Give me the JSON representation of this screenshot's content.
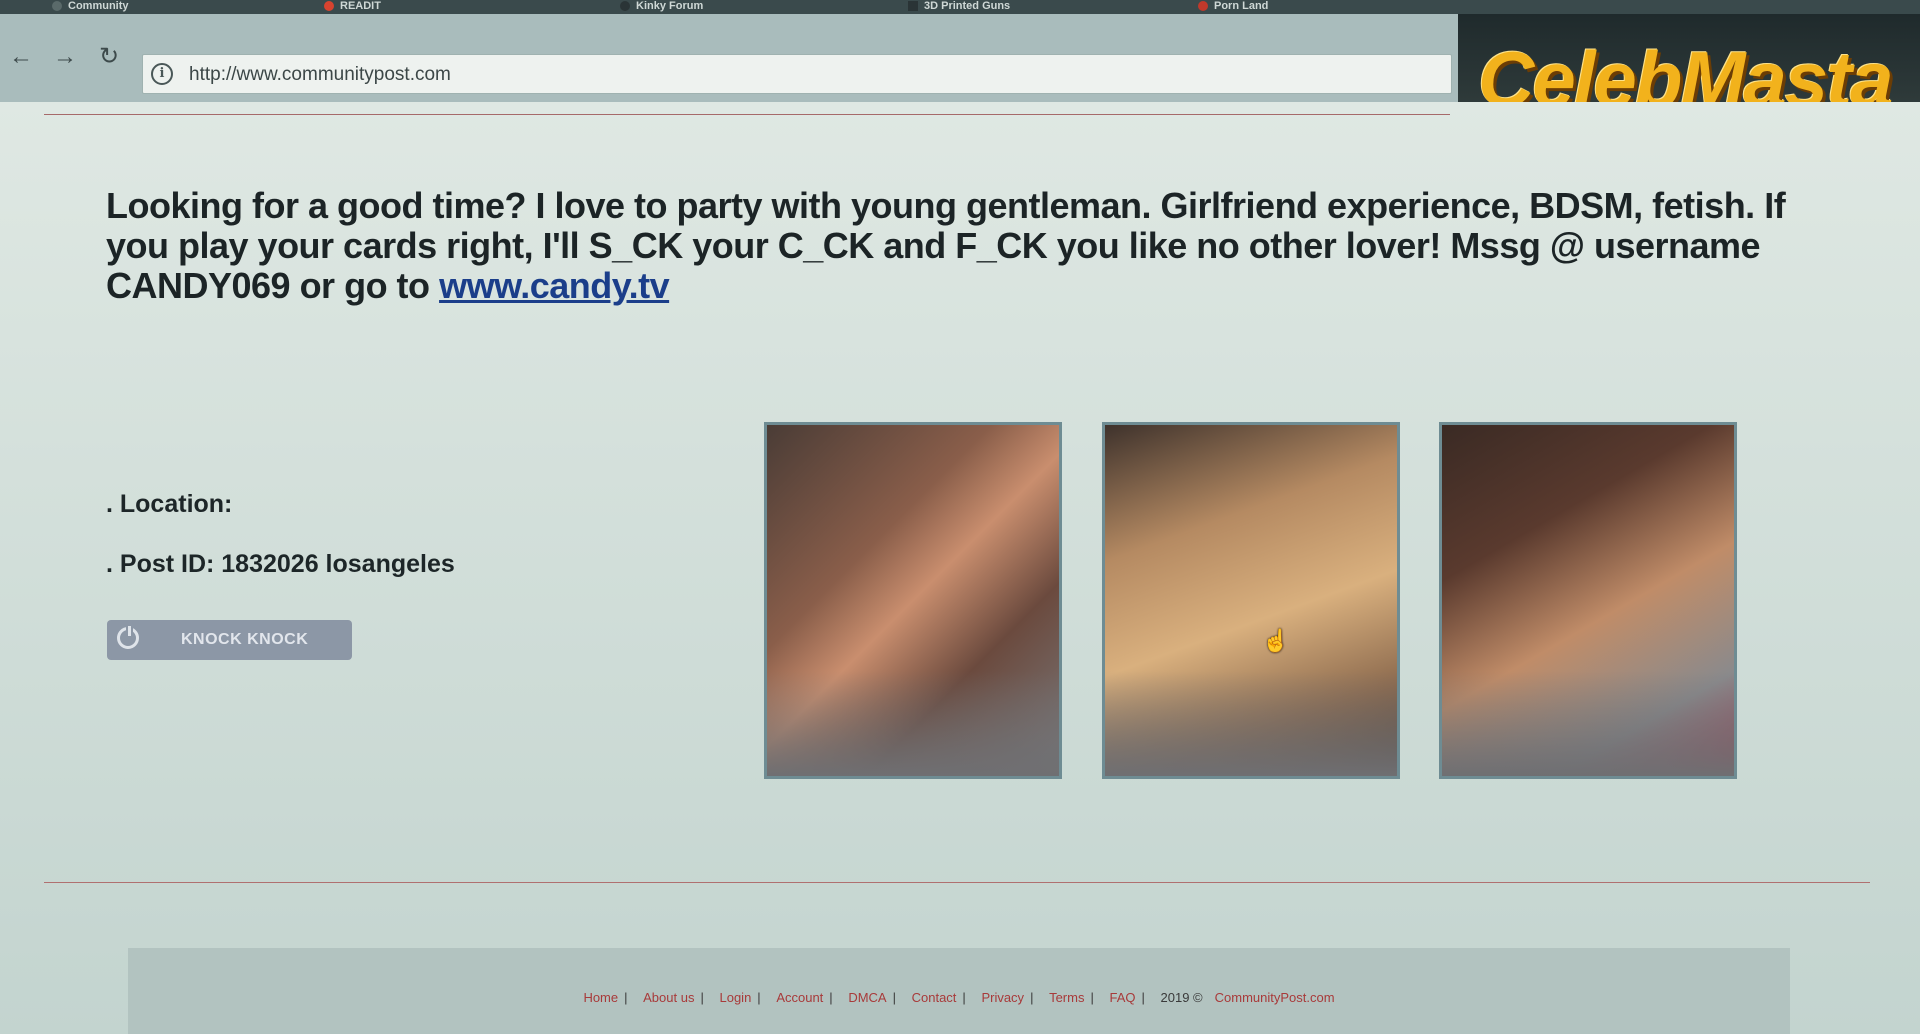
{
  "browser": {
    "tabs": [
      {
        "label": "Community",
        "icon_color": "#5a6a6a"
      },
      {
        "label": "READIT",
        "icon_color": "#d8432f"
      },
      {
        "label": "Kinky Forum",
        "icon_color": "#2a3436"
      },
      {
        "label": "3D Printed Guns",
        "icon_color": "#2a3436"
      },
      {
        "label": "Porn Land",
        "icon_color": "#c0392b"
      }
    ],
    "url": "http://www.communitypost.com"
  },
  "watermark": "CelebMasta",
  "post": {
    "text_before_link": "Looking for a good time? I love to party with young gentleman. Girlfriend experience, BDSM, fetish. If you play your cards right, I'll S_CK your C_CK and F_CK you like no other lover! Mssg @ username CANDY069 or go to",
    "link_text": "www.candy.tv",
    "location": ". Location:",
    "post_id": ". Post ID: 1832026 losangeles",
    "button_label": "KNOCK KNOCK"
  },
  "footer": {
    "links": [
      "Home",
      "About us",
      "Login",
      "Account",
      "DMCA",
      "Contact",
      "Privacy",
      "Terms",
      "FAQ"
    ],
    "separator": "|",
    "copyright_year": "2019 ©",
    "copyright_site": "CommunityPost.com"
  },
  "colors": {
    "link": "#1b3e8a",
    "footer_link": "#a83a3a",
    "button_bg": "#8c97a6",
    "logo": "#f2b21c"
  }
}
